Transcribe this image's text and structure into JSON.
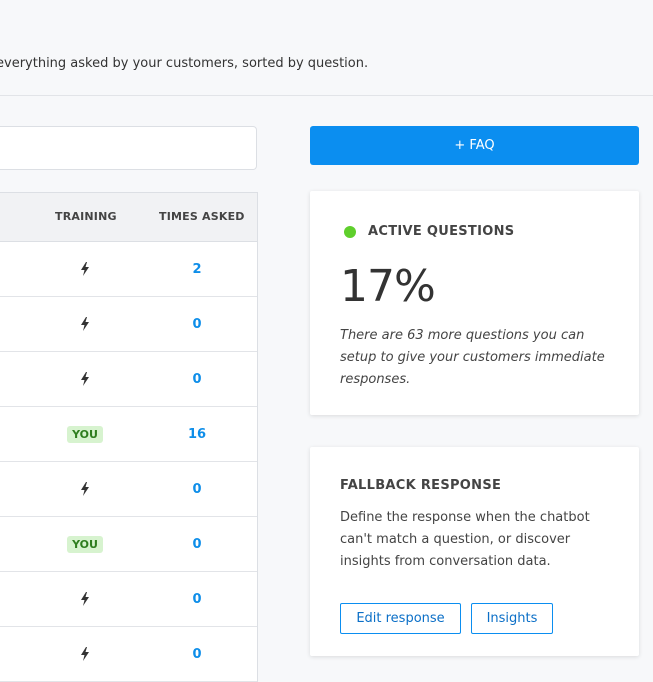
{
  "header": {
    "subtitle": "everything asked by your customers, sorted by question."
  },
  "search": {
    "value": "",
    "placeholder": ""
  },
  "table": {
    "columns": {
      "training": "TRAINING",
      "times_asked": "TIMES ASKED"
    },
    "rows": [
      {
        "training": "bolt",
        "times_asked": "2"
      },
      {
        "training": "bolt",
        "times_asked": "0"
      },
      {
        "training": "bolt",
        "times_asked": "0"
      },
      {
        "training": "YOU",
        "times_asked": "16"
      },
      {
        "training": "bolt",
        "times_asked": "0"
      },
      {
        "training": "YOU",
        "times_asked": "0"
      },
      {
        "training": "bolt",
        "times_asked": "0"
      },
      {
        "training": "bolt",
        "times_asked": "0"
      }
    ]
  },
  "faq_button": {
    "label": "+ FAQ"
  },
  "active_card": {
    "title": "ACTIVE QUESTIONS",
    "percent": "17%",
    "description": "There are 63 more questions you can setup to give your customers immediate responses.",
    "status_color": "#5fcf2c"
  },
  "fallback_card": {
    "title": "FALLBACK RESPONSE",
    "description": "Define the response when the chatbot can't match a question, or discover insights from conversation data.",
    "edit_label": "Edit response",
    "insights_label": "Insights"
  },
  "colors": {
    "accent": "#0b8ef0",
    "badge_bg": "#d7f3cf",
    "badge_text": "#2e7d1e"
  }
}
